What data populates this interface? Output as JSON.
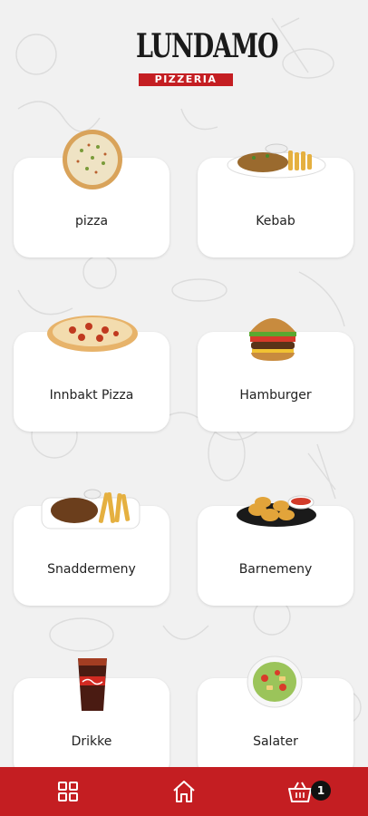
{
  "brand": {
    "name": "LUNDAMO",
    "subtitle": "PIZZERIA",
    "color": "#c41e22"
  },
  "categories": [
    {
      "label": "pizza",
      "icon": "pizza-image"
    },
    {
      "label": "Kebab",
      "icon": "kebab-plate-image"
    },
    {
      "label": "Innbakt Pizza",
      "icon": "calzone-image"
    },
    {
      "label": "Hamburger",
      "icon": "hamburger-image"
    },
    {
      "label": "Snaddermeny",
      "icon": "snack-plate-image"
    },
    {
      "label": "Barnemeny",
      "icon": "nuggets-image"
    },
    {
      "label": "Drikke",
      "icon": "cola-glass-image"
    },
    {
      "label": "Salater",
      "icon": "salad-image"
    }
  ],
  "bottom_nav": {
    "items": [
      {
        "icon": "grid-icon"
      },
      {
        "icon": "home-icon"
      },
      {
        "icon": "cart-icon"
      }
    ],
    "cart_count": "1"
  }
}
